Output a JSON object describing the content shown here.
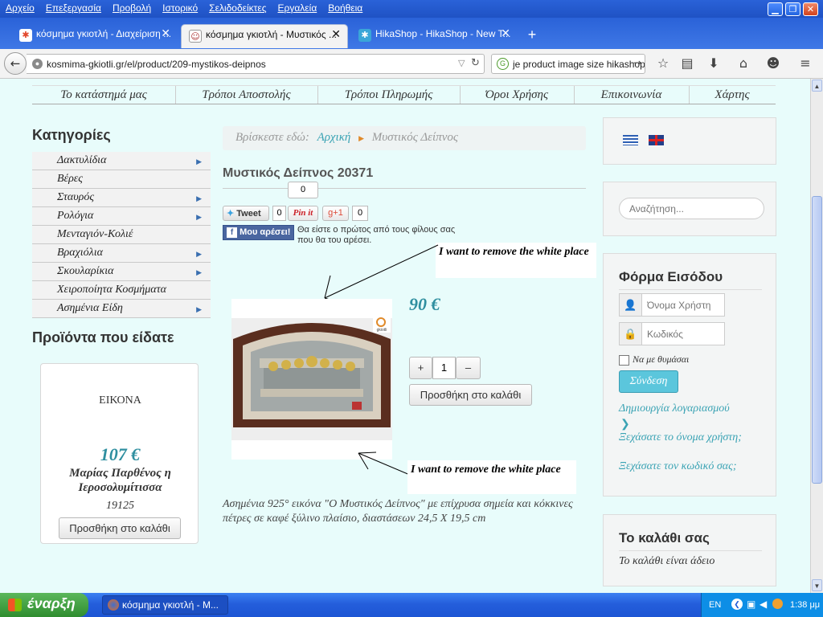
{
  "menubar": {
    "items": [
      "Αρχείο",
      "Επεξεργασία",
      "Προβολή",
      "Ιστορικό",
      "Σελιδοδείκτες",
      "Εργαλεία",
      "Βοήθεια"
    ],
    "min_glyph": "▁",
    "max_glyph": "❐",
    "close_glyph": "✕"
  },
  "tabs": [
    {
      "label": "κόσμημα γκιοτλή - Διαχείριση ...",
      "icon": "joomla-icon",
      "active": false
    },
    {
      "label": "κόσμημα γκιοτλή - Μυστικός ...",
      "icon": "site-favicon",
      "active": true
    },
    {
      "label": "HikaShop - HikaShop - New T...",
      "icon": "hikashop-icon",
      "active": false
    }
  ],
  "tab_close_glyph": "✕",
  "new_tab_glyph": "+",
  "nav": {
    "url": "kosmima-gkiotli.gr/el/product/209-mystikos-deipnos",
    "search_text": "je product image size hikashop"
  },
  "site": {
    "top_nav": [
      "Το κατάστημά μας",
      "Τρόποι Αποστολής",
      "Τρόποι Πληρωμής",
      "Όροι Χρήσης",
      "Επικοινωνία",
      "Χάρτης"
    ],
    "categories_heading": "Κατηγορίες",
    "categories": [
      {
        "label": "Δακτυλίδια",
        "has_sub": true
      },
      {
        "label": "Βέρες",
        "has_sub": false
      },
      {
        "label": "Σταυρός",
        "has_sub": true
      },
      {
        "label": "Ρολόγια",
        "has_sub": true
      },
      {
        "label": "Μενταγιόν-Κολιέ",
        "has_sub": false
      },
      {
        "label": "Βραχιόλια",
        "has_sub": true
      },
      {
        "label": "Σκουλαρίκια",
        "has_sub": true
      },
      {
        "label": "Χειροποίητα Κοσμήματα",
        "has_sub": false
      },
      {
        "label": "Ασημένια Είδη",
        "has_sub": true
      }
    ],
    "sub_arrow": "▶",
    "viewed_heading": "Προϊόντα που είδατε",
    "viewed_product": {
      "image_caption": "ΕΙΚΟΝΑ",
      "price": "107 €",
      "name": "Μαρίας Παρθένος η Ιεροσολυμίτισσα",
      "code": "19125",
      "add_to_cart": "Προσθήκη στο καλάθι"
    },
    "breadcrumb": {
      "prefix": "Βρίσκεστε εδώ:",
      "home": "Αρχική",
      "current": "Μυστικός Δείπνος"
    },
    "product": {
      "title": "Μυστικός Δείπνος 20371",
      "price": "90 €",
      "quantity": "1",
      "plus": "+",
      "minus": "–",
      "add_to_cart": "Προσθήκη στο καλάθι",
      "description": "Ασημένια 925° εικόνα \"Ο Μυστικός Δείπνος\" με επίχρυσα σημεία και κόκκινες πέτρες σε καφέ ξύλινο πλαίσιο, διαστάσεων 24,5 Χ 19,5 cm",
      "image_badge": "gkiotli"
    },
    "social": {
      "tweet": "Tweet",
      "tweet_count": "0",
      "pinit": "Pin it",
      "pin_count": "0",
      "gplus": "g+1",
      "gplus_count": "0",
      "fb_like": "Μου αρέσει!",
      "fb_text": "Θα είστε ο πρώτος από τους φίλους σας που θα του αρέσει."
    },
    "annotations": {
      "top": "I want to remove the white place",
      "bottom": "I want to remove the white place"
    },
    "search_placeholder": "Αναζήτηση...",
    "login": {
      "heading": "Φόρμα Εισόδου",
      "username_placeholder": "Όνομα Χρήστη",
      "password_placeholder": "Κωδικός",
      "remember": "Να με θυμάσαι",
      "submit": "Σύνδεση",
      "create_account": "Δημιουργία λογαριασμού",
      "forgot_username": "Ξεχάσατε το όνομα χρήστη;",
      "forgot_password": "Ξεχάσατε τον κωδικό σας;"
    },
    "cart": {
      "heading": "Το καλάθι σας",
      "empty": "Το καλάθι είναι άδειο"
    }
  },
  "taskbar": {
    "start": "έναρξη",
    "task": "κόσμημα γκιοτλή - Μ...",
    "lang": "EN",
    "clock": "1:38 μμ"
  },
  "colors": {
    "page_bg": "#e8fcfb",
    "accent": "#2f8fa0",
    "login_button": "#5bc6dc",
    "titlebar": "#2a62d8",
    "taskbar": "#245edb"
  }
}
